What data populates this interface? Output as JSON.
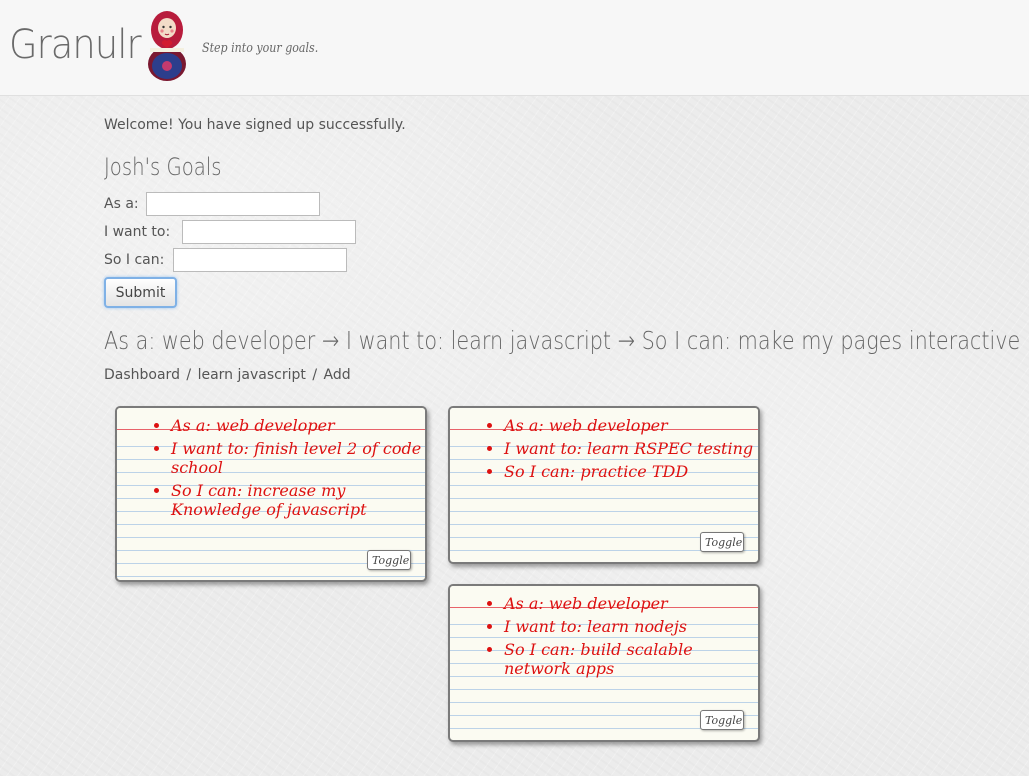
{
  "header": {
    "brand": "Granulr",
    "tagline": "Step into your goals."
  },
  "flash": "Welcome! You have signed up successfully.",
  "goals_title": "Josh's Goals",
  "form": {
    "as_a_label": "As a:",
    "as_a_value": "",
    "i_want_to_label": "I want to:",
    "i_want_to_value": "",
    "so_i_can_label": "So I can:",
    "so_i_can_value": "",
    "submit_label": "Submit"
  },
  "story_heading": "As a: web developer → I want to: learn javascript → So I can: make my pages interactive",
  "breadcrumb": {
    "dashboard": "Dashboard",
    "sep1": "/",
    "current": "learn javascript",
    "sep2": "/",
    "add": "Add"
  },
  "cards": [
    {
      "as_a": "As a: web developer",
      "i_want_to": "I want to: finish level 2 of code school",
      "so_i_can": "So I can: increase my Knowledge of javascript",
      "toggle": "Toggle c"
    },
    {
      "as_a": "As a: web developer",
      "i_want_to": "I want to: learn RSPEC testing",
      "so_i_can": "So I can: practice TDD",
      "toggle": "Toggle c"
    },
    {
      "as_a": "As a: web developer",
      "i_want_to": "I want to: learn nodejs",
      "so_i_can": "So I can: build scalable network apps",
      "toggle": "Toggle c"
    }
  ],
  "colors": {
    "card_ink": "#dd1111",
    "card_margin_line": "#e8636a",
    "card_rule_line": "#bcd3e8",
    "submit_focus": "#7fb1e6"
  }
}
